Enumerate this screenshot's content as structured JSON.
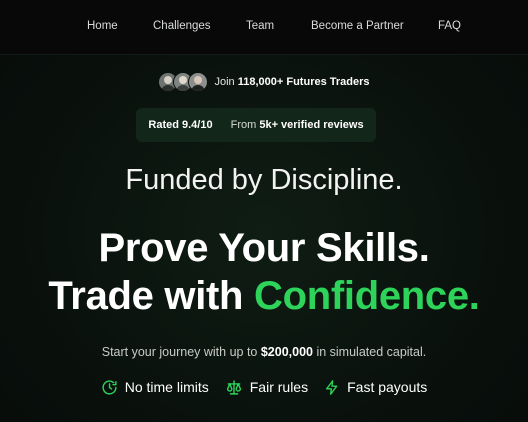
{
  "nav": {
    "items": [
      "Home",
      "Challenges",
      "Team",
      "Become a Partner",
      "FAQ"
    ]
  },
  "social_proof": {
    "prefix": "Join ",
    "count": "118,000+ Futures Traders"
  },
  "rating": {
    "score": "Rated 9.4/10",
    "from_prefix": "From ",
    "from_value": "5k+ verified reviews"
  },
  "hero": {
    "subtitle": "Funded by Discipline.",
    "line1": "Prove Your Skills.",
    "line2_plain": "Trade with ",
    "line2_accent": "Confidence."
  },
  "tagline": {
    "prefix": "Start your journey with up to ",
    "amount": "$200,000",
    "suffix": " in simulated capital."
  },
  "features": [
    {
      "icon": "clock-icon",
      "label": "No time limits"
    },
    {
      "icon": "scales-icon",
      "label": "Fair rules"
    },
    {
      "icon": "lightning-icon",
      "label": "Fast payouts"
    }
  ],
  "colors": {
    "accent": "#2ed35a",
    "background": "#0a120d",
    "badge": "#13261a"
  }
}
